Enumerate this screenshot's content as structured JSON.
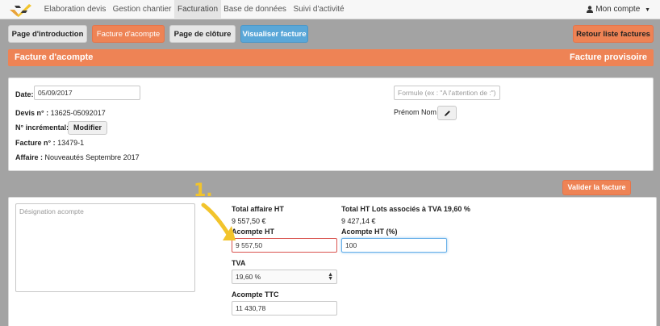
{
  "nav": {
    "items": [
      {
        "label": "Elaboration devis"
      },
      {
        "label": "Gestion chantier"
      },
      {
        "label": "Facturation"
      },
      {
        "label": "Base de données"
      },
      {
        "label": "Suivi d'activité"
      }
    ],
    "account": "Mon compte"
  },
  "toolbar": {
    "intro": "Page d'introduction",
    "acompte": "Facture d'acompte",
    "cloture": "Page de clôture",
    "visualiser": "Visualiser facture",
    "retour": "Retour liste factures"
  },
  "title": {
    "left": "Facture d'acompte",
    "right": "Facture provisoire"
  },
  "header_panel": {
    "date_label": "Date:",
    "date_value": "05/09/2017",
    "formule_placeholder": "Formule (ex : \"A l'attention de :\")",
    "prenom_nom": "Prénom Nom",
    "devis_label": "Devis n° :",
    "devis_value": "13625-05092017",
    "incremental_label": "N° incrémental:",
    "modifier": "Modifier",
    "facture_label": "Facture n° :",
    "facture_value": "13479-1",
    "affaire_label": "Affaire :",
    "affaire_value": "Nouveautés Septembre 2017"
  },
  "valider": "Valider la facture",
  "annotation": "1.",
  "acompte_panel": {
    "designation_placeholder": "Désignation acompte",
    "total_affaire_label": "Total affaire HT",
    "total_affaire_value": "9 557,50 €",
    "total_lots_label": "Total HT Lots associés à TVA 19,60 %",
    "total_lots_value": "9 427,14 €",
    "acompte_ht_label": "Acompte HT",
    "acompte_ht_value": "9 557,50",
    "acompte_pct_label": "Acompte HT (%)",
    "acompte_pct_value": "100",
    "tva_label": "TVA",
    "tva_value": "19,60 %",
    "ttc_label": "Acompte TTC",
    "ttc_value": "11 430,78"
  },
  "colors": {
    "accent_orange": "#ee8355",
    "blue_button": "#5aa7d8",
    "error_border": "#d9534f",
    "focus_border": "#66afe9",
    "annotation_yellow": "#f2c42c"
  }
}
